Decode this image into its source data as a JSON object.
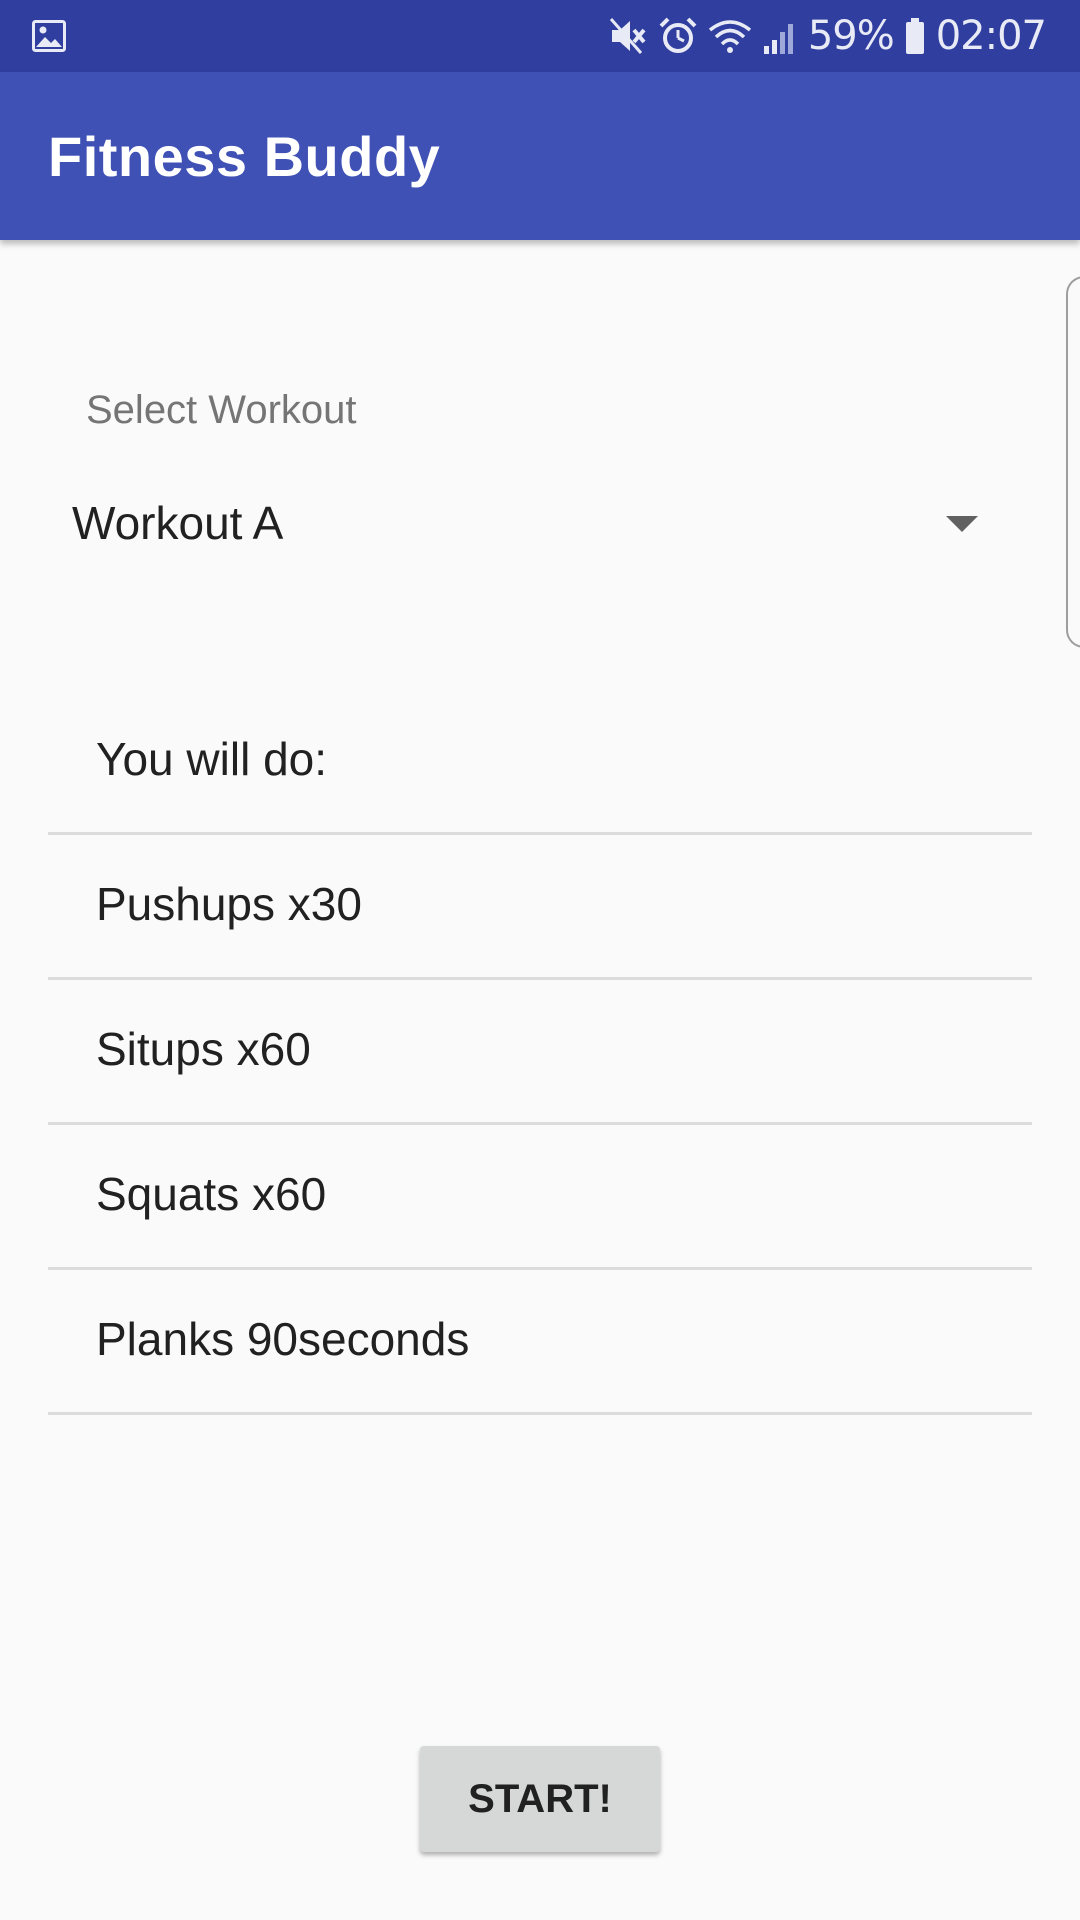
{
  "status_bar": {
    "battery": "59%",
    "time": "02:07",
    "icons": [
      "image-icon",
      "mute-icon",
      "alarm-icon",
      "wifi-icon",
      "signal-icon",
      "battery-icon"
    ]
  },
  "app_bar": {
    "title": "Fitness Buddy",
    "color": "#3f51b5",
    "status_color": "#303f9f"
  },
  "workout_select": {
    "label": "Select Workout",
    "selected": "Workout A"
  },
  "exercise_list": {
    "header": "You will do:",
    "items": [
      "Pushups x30",
      "Situps x60",
      "Squats x60",
      "Planks 90seconds"
    ]
  },
  "start_button": {
    "label": "START!"
  }
}
